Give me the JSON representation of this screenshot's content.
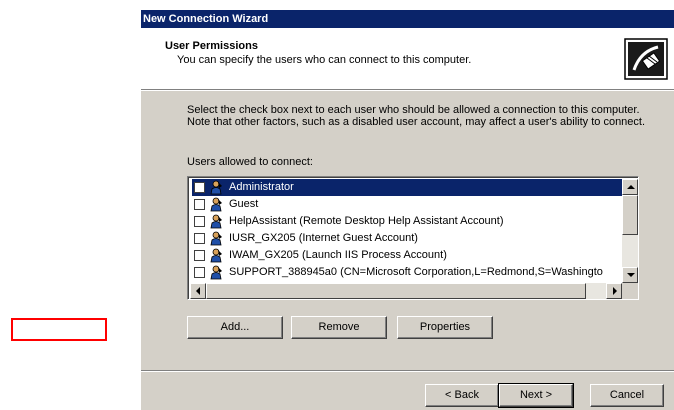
{
  "window": {
    "title": "New Connection Wizard"
  },
  "header": {
    "title": "User Permissions",
    "subtitle": "You can specify the users who can connect to this computer.",
    "icon": "network-cable-icon"
  },
  "description": "Select the check box next to each user who should be allowed a connection to this computer.  Note that other factors, such as a disabled user account, may affect a user's ability to connect.",
  "users_label": "Users allowed to connect:",
  "users": [
    {
      "name": "Administrator",
      "checked": false,
      "selected": true
    },
    {
      "name": "Guest",
      "checked": false,
      "selected": false
    },
    {
      "name": "HelpAssistant (Remote Desktop Help Assistant Account)",
      "checked": false,
      "selected": false
    },
    {
      "name": "IUSR_GX205 (Internet Guest Account)",
      "checked": false,
      "selected": false
    },
    {
      "name": "IWAM_GX205 (Launch IIS Process Account)",
      "checked": false,
      "selected": false
    },
    {
      "name": "SUPPORT_388945a0 (CN=Microsoft Corporation,L=Redmond,S=Washingto",
      "checked": false,
      "selected": false
    }
  ],
  "buttons": {
    "add": "Add...",
    "remove": "Remove",
    "properties": "Properties",
    "back": "< Back",
    "next": "Next >",
    "cancel": "Cancel"
  },
  "colors": {
    "title_bar": "#0a246a",
    "dialog_face": "#d4d0c8",
    "highlight_box": "#ff0000"
  }
}
